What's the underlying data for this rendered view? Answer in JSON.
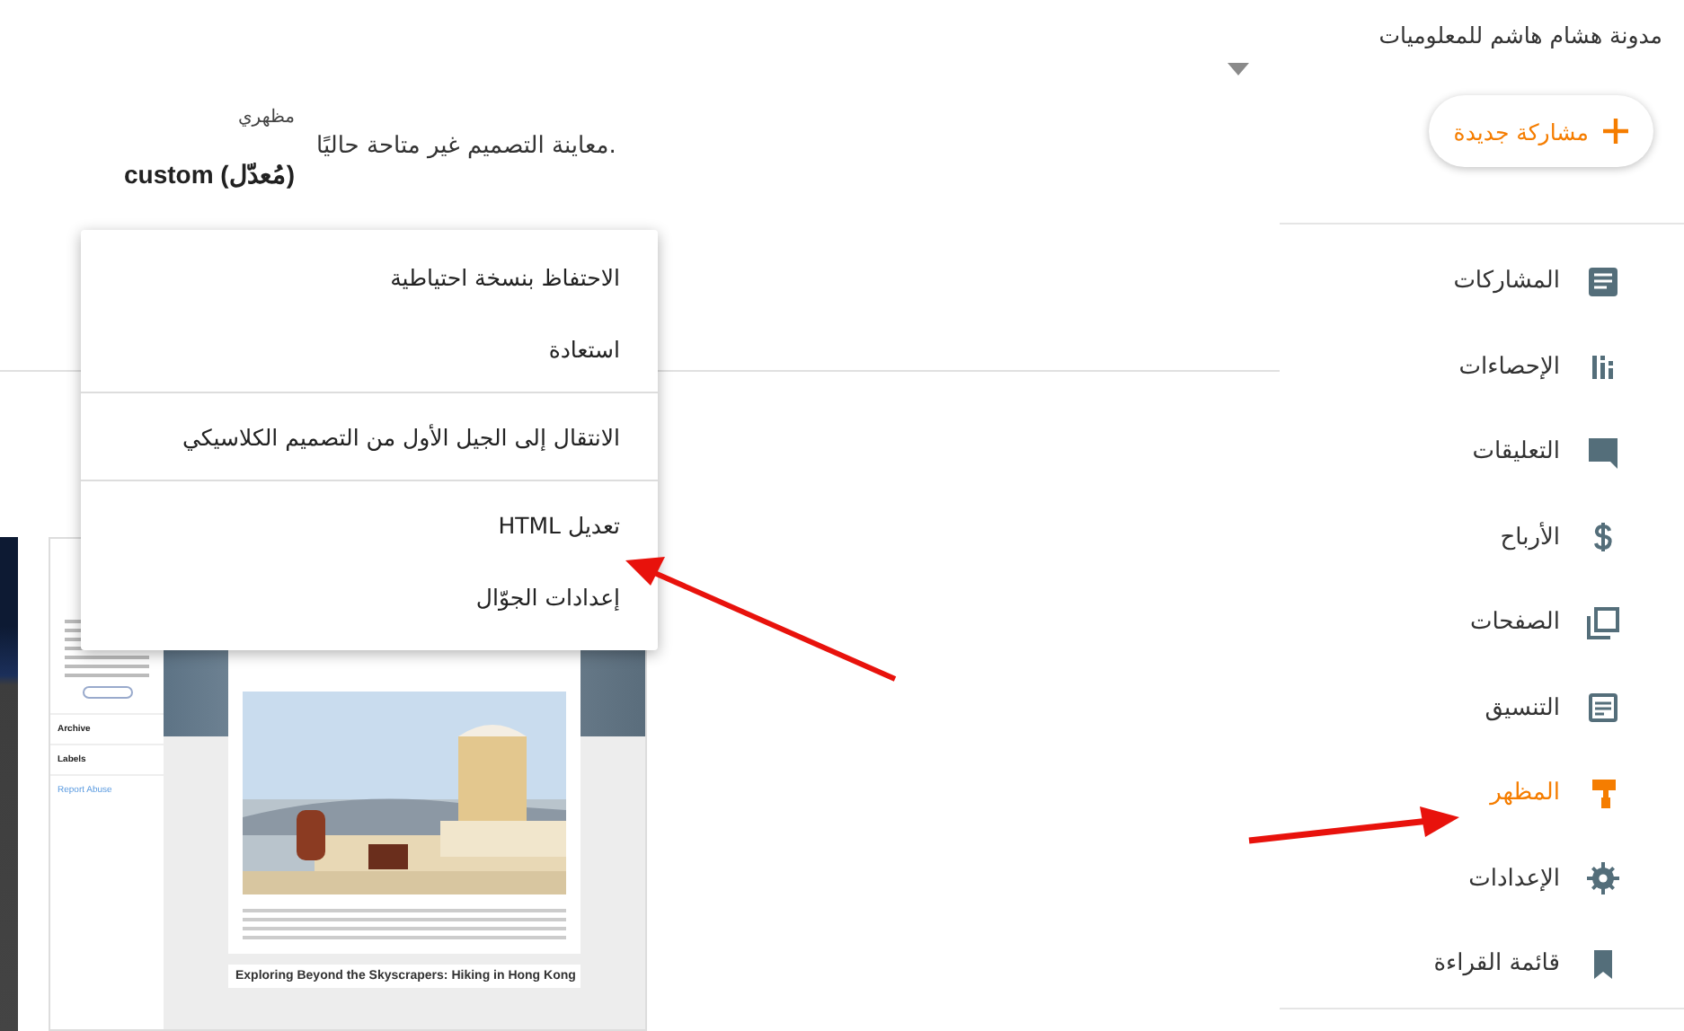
{
  "header": {
    "blog_title": "مدونة هشام هاشم للمعلوميات"
  },
  "new_post_button": {
    "label": "مشاركة جديدة"
  },
  "sidebar": {
    "items": [
      {
        "label": "المشاركات",
        "kind": "posts",
        "selected": false
      },
      {
        "label": "الإحصاءات",
        "kind": "stats",
        "selected": false
      },
      {
        "label": "التعليقات",
        "kind": "comments",
        "selected": false
      },
      {
        "label": "الأرباح",
        "kind": "earnings",
        "selected": false
      },
      {
        "label": "الصفحات",
        "kind": "pages",
        "selected": false
      },
      {
        "label": "التنسيق",
        "kind": "layout",
        "selected": false
      },
      {
        "label": "المظهر",
        "kind": "theme",
        "selected": true
      },
      {
        "label": "الإعدادات",
        "kind": "settings",
        "selected": false
      },
      {
        "label": "قائمة القراءة",
        "kind": "reading",
        "selected": false
      }
    ]
  },
  "theme": {
    "label": "مظهري",
    "name": "custom (مُعدّل)",
    "preview_note": "معاينة التصميم غير متاحة حاليًا."
  },
  "menu": {
    "sections": [
      {
        "items": [
          "الاحتفاظ بنسخة احتياطية",
          "استعادة"
        ]
      },
      {
        "items": [
          "الانتقال إلى الجيل الأول من التصميم الكلاسيكي"
        ]
      },
      {
        "items": [
          "تعديل HTML",
          "إعدادات الجوّال"
        ]
      }
    ]
  },
  "preview": {
    "sidebar_links": [
      "Archive",
      "Labels",
      "Report Abuse"
    ],
    "post_title": "Exploring Beyond the Skyscrapers: Hiking in Hong Kong"
  }
}
